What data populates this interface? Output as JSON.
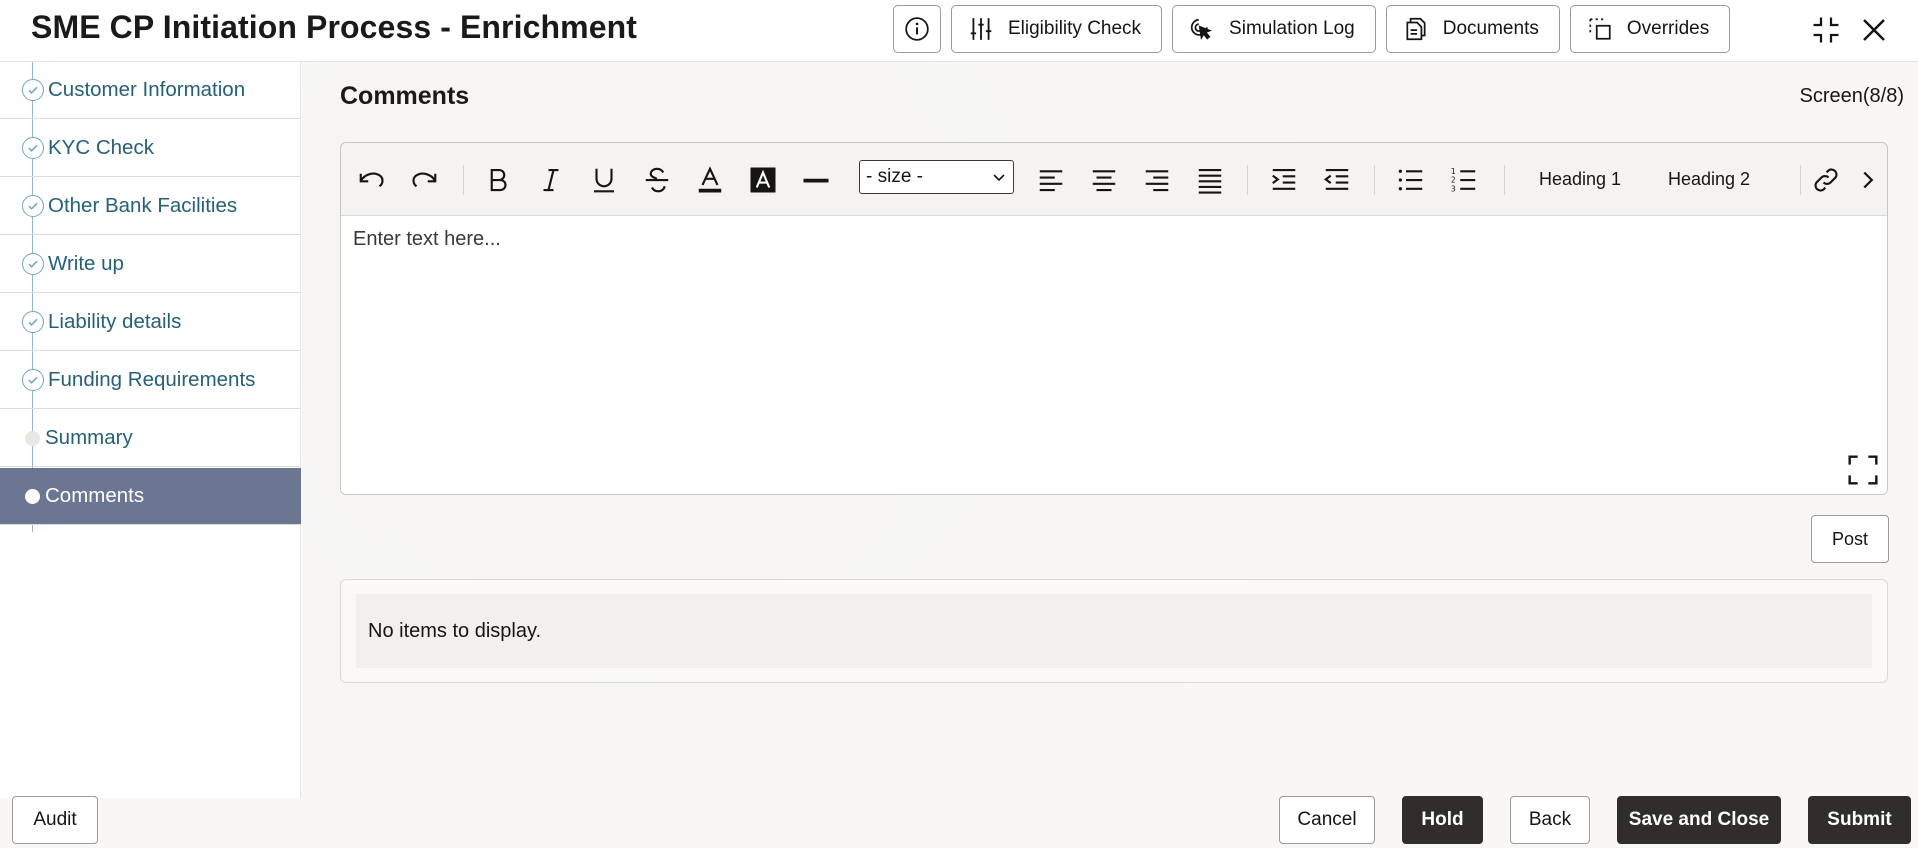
{
  "header": {
    "title": "SME CP Initiation Process - Enrichment",
    "buttons": {
      "eligibility": "Eligibility Check",
      "simulation": "Simulation Log",
      "documents": "Documents",
      "overrides": "Overrides"
    }
  },
  "sidebar": {
    "items": [
      {
        "label": "Customer Information",
        "state": "completed"
      },
      {
        "label": "KYC Check",
        "state": "completed"
      },
      {
        "label": "Other Bank Facilities",
        "state": "completed"
      },
      {
        "label": "Write up",
        "state": "completed"
      },
      {
        "label": "Liability details",
        "state": "completed"
      },
      {
        "label": "Funding Requirements",
        "state": "completed"
      },
      {
        "label": "Summary",
        "state": "pending"
      },
      {
        "label": "Comments",
        "state": "active"
      }
    ]
  },
  "main": {
    "section_title": "Comments",
    "screen_indicator": "Screen(8/8)",
    "editor": {
      "size_select": "- size -",
      "heading1": "Heading 1",
      "heading2": "Heading 2",
      "placeholder": "Enter text here..."
    },
    "post_label": "Post",
    "empty_message": "No items to display."
  },
  "footer": {
    "audit": "Audit",
    "cancel": "Cancel",
    "hold": "Hold",
    "back": "Back",
    "save_close": "Save and Close",
    "submit": "Submit"
  },
  "colors": {
    "active_nav_bg": "#6b7693",
    "nav_text": "#24607a",
    "dark_button": "#312d2a"
  }
}
